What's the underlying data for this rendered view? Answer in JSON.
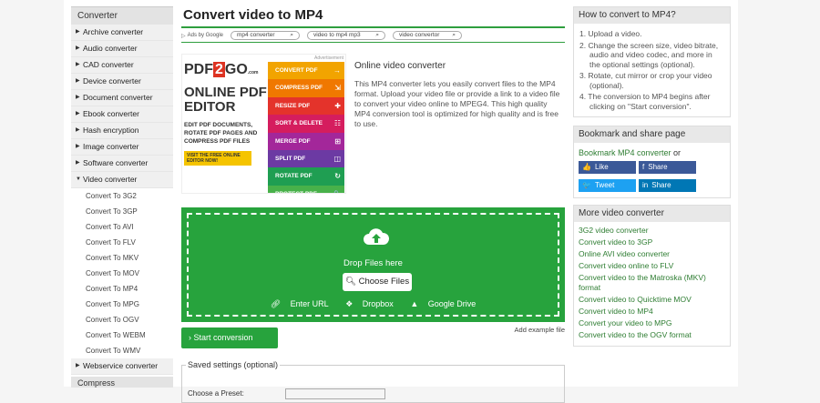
{
  "sidebar": {
    "header": "Converter",
    "items": [
      {
        "label": "Archive converter",
        "expanded": false
      },
      {
        "label": "Audio converter",
        "expanded": false
      },
      {
        "label": "CAD converter",
        "expanded": false
      },
      {
        "label": "Device converter",
        "expanded": false
      },
      {
        "label": "Document converter",
        "expanded": false
      },
      {
        "label": "Ebook converter",
        "expanded": false
      },
      {
        "label": "Hash encryption",
        "expanded": false
      },
      {
        "label": "Image converter",
        "expanded": false
      },
      {
        "label": "Software converter",
        "expanded": false
      },
      {
        "label": "Video converter",
        "expanded": true
      }
    ],
    "subitems": [
      "Convert To 3G2",
      "Convert To 3GP",
      "Convert To AVI",
      "Convert To FLV",
      "Convert To MKV",
      "Convert To MOV",
      "Convert To MP4",
      "Convert To MPG",
      "Convert To OGV",
      "Convert To WEBM",
      "Convert To WMV"
    ],
    "last_item": "Webservice converter",
    "next_header": "Compress"
  },
  "main": {
    "title": "Convert video to MP4",
    "ads_label": "Ads by Google",
    "ad_links": [
      "mp4 converter",
      "video to mp4 mp3",
      "video convertor"
    ],
    "ad": {
      "advert_label": "Advertisement",
      "logo_pdf": "PDF",
      "logo_2": "2",
      "logo_go": "GO",
      "logo_com": ".com",
      "headline": "ONLINE PDF EDITOR",
      "sub": "EDIT PDF DOCUMENTS, ROTATE PDF PAGES AND COMPRESS PDF FILES",
      "cta": "VISIT THE FREE ONLINE EDITOR NOW!",
      "buttons": [
        {
          "label": "CONVERT PDF",
          "color": "#f2a400",
          "icon": "→"
        },
        {
          "label": "COMPRESS PDF",
          "color": "#f07800",
          "icon": "⇲"
        },
        {
          "label": "RESIZE PDF",
          "color": "#e4332b",
          "icon": "✚"
        },
        {
          "label": "SORT & DELETE",
          "color": "#d51d5e",
          "icon": "☷"
        },
        {
          "label": "MERGE PDF",
          "color": "#a3279a",
          "icon": "⊞"
        },
        {
          "label": "SPLIT PDF",
          "color": "#6c3aa3",
          "icon": "◫"
        },
        {
          "label": "ROTATE PDF",
          "color": "#1f9e52",
          "icon": "↻"
        },
        {
          "label": "PROTECT PDF",
          "color": "#48b14a",
          "icon": "🔒"
        }
      ]
    },
    "desc_title": "Online video converter",
    "desc_text": "This MP4 converter lets you easily convert files to the MP4 format. Upload your video file or provide a link to a video file to convert your video online to MPEG4. This high quality MP4 conversion tool is optimized for high quality and is free to use.",
    "drop_text": "Drop Files here",
    "choose_files": "Choose Files",
    "enter_url": "Enter URL",
    "dropbox": "Dropbox",
    "gdrive": "Google Drive",
    "start_button": "Start conversion",
    "add_example": "Add example file",
    "saved_settings": "Saved settings (optional)",
    "saved_row_label": "Choose a Preset:"
  },
  "right": {
    "howto_title": "How to convert to MP4?",
    "steps": [
      "1. Upload a video.",
      "2. Change the screen size, video bitrate, audio and video codec, and more in the optional settings (optional).",
      "3. Rotate, cut mirror or crop your video (optional).",
      "4. The conversion to MP4 begins after clicking on \"Start conversion\"."
    ],
    "bookmark_title": "Bookmark and share page",
    "bookmark_link": "Bookmark MP4 converter",
    "bookmark_or": " or",
    "social": [
      {
        "label": "Like",
        "color": "#3b5998",
        "icon": "👍"
      },
      {
        "label": "Share",
        "color": "#3b5998",
        "icon": "f"
      },
      {
        "label": "Tweet",
        "color": "#1da1f2",
        "icon": "🐦"
      },
      {
        "label": "Share",
        "color": "#0077b5",
        "icon": "in"
      }
    ],
    "more_title": "More video converter",
    "more_links": [
      "3G2 video converter",
      "Convert video to 3GP",
      "Online AVI video converter",
      "Convert video online to FLV",
      "Convert video to the Matroska (MKV) format",
      "Convert video to Quicktime MOV",
      "Convert video to MP4",
      "Convert your video to MPG",
      "Convert video to the OGV format"
    ]
  }
}
